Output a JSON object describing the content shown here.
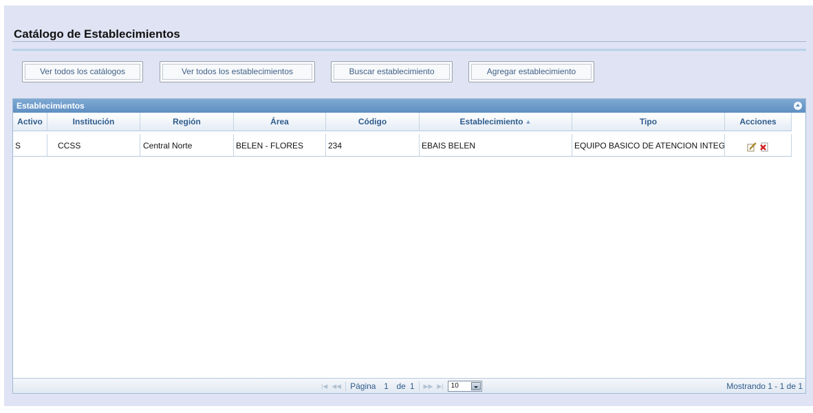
{
  "page": {
    "title": "Catálogo de Establecimientos"
  },
  "toolbar": {
    "buttons": [
      {
        "label": "Ver todos los catálogos"
      },
      {
        "label": "Ver todos los establecimientos"
      },
      {
        "label": "Buscar establecimiento"
      },
      {
        "label": "Agregar establecimiento"
      }
    ]
  },
  "grid": {
    "caption": "Establecimientos",
    "columns": [
      "Activo",
      "Institución",
      "Región",
      "Área",
      "Código",
      "Establecimiento",
      "Tipo",
      "Acciones"
    ],
    "sorted_column": "Establecimiento",
    "rows": [
      {
        "activo": "S",
        "institucion": "CCSS",
        "region": "Central Norte",
        "area": "BELEN - FLORES",
        "codigo": "234",
        "establecimiento": "EBAIS BELEN",
        "tipo": "EQUIPO BASICO DE ATENCION INTEGRAL",
        "actions": [
          "edit-icon",
          "delete-icon"
        ]
      }
    ],
    "pager": {
      "page_label": "Página",
      "page": "1",
      "of_label": "de",
      "total_pages": "1",
      "rows_per_page": "10",
      "record_info": "Mostrando 1 - 1 de 1"
    }
  },
  "colors": {
    "accent": "#5f8fc2",
    "header_text": "#2e5b8a",
    "panel_bg": "#dfe3f3"
  }
}
